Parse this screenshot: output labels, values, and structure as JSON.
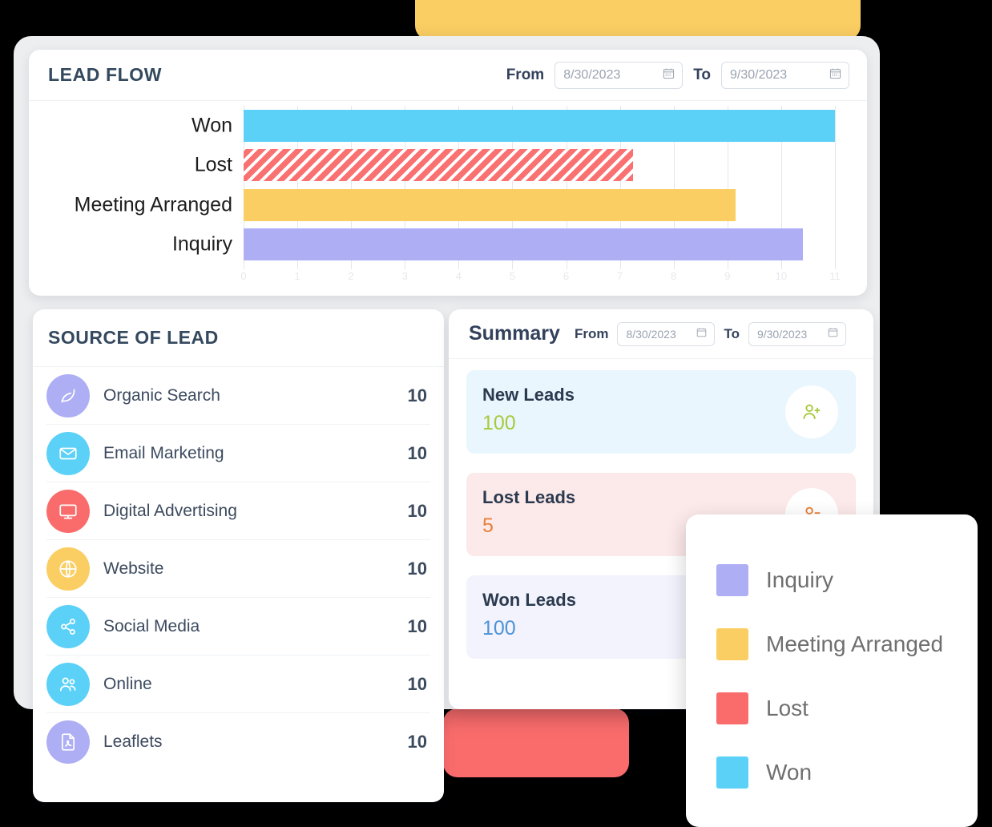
{
  "lead_flow": {
    "title": "LEAD FLOW",
    "from_label": "From",
    "to_label": "To",
    "from_value": "8/30/2023",
    "to_value": "9/30/2023",
    "calendar_icon": "calendar-icon"
  },
  "chart_data": {
    "type": "bar",
    "orientation": "horizontal",
    "title": "LEAD FLOW",
    "xlabel": "",
    "ylabel": "",
    "categories": [
      "Won",
      "Lost",
      "Meeting Arranged",
      "Inquiry"
    ],
    "values": [
      11,
      7.25,
      9.15,
      10.4
    ],
    "colors": [
      "#5BD1F7",
      "#FA7171",
      "#FBCE63",
      "#AEAEF5"
    ],
    "patterns": [
      "solid",
      "diagonal-stripes",
      "solid",
      "solid"
    ],
    "xlim": [
      0,
      11
    ],
    "xticks": [
      0,
      1,
      2,
      3,
      4,
      5,
      6,
      7,
      8,
      9,
      10,
      11
    ],
    "xticklabels": [
      "0",
      "1",
      "2",
      "3",
      "4",
      "5",
      "6",
      "7",
      "8",
      "9",
      "10",
      "11"
    ],
    "grid": true,
    "legend": {
      "position": "floating-bottom-right",
      "entries": [
        {
          "label": "Inquiry",
          "color": "#AEAEF5"
        },
        {
          "label": "Meeting Arranged",
          "color": "#FBCE63"
        },
        {
          "label": "Lost",
          "color": "#FA6C6C"
        },
        {
          "label": "Won",
          "color": "#5BD1F7"
        }
      ]
    }
  },
  "source_of_lead": {
    "title": "SOURCE OF LEAD",
    "rows": [
      {
        "name": "Organic Search",
        "value": "10",
        "icon": "leaf-icon",
        "color": "#AEAEF5"
      },
      {
        "name": "Email Marketing",
        "value": "10",
        "icon": "envelope-icon",
        "color": "#5BD1F7"
      },
      {
        "name": "Digital Advertising",
        "value": "10",
        "icon": "monitor-icon",
        "color": "#FA6C6C"
      },
      {
        "name": "Website",
        "value": "10",
        "icon": "globe-icon",
        "color": "#FBCE63"
      },
      {
        "name": "Social Media",
        "value": "10",
        "icon": "share-icon",
        "color": "#5BD1F7"
      },
      {
        "name": "Online",
        "value": "10",
        "icon": "users-icon",
        "color": "#5BD1F7"
      },
      {
        "name": "Leaflets",
        "value": "10",
        "icon": "pdf-file-icon",
        "color": "#AEAEF5"
      }
    ]
  },
  "summary": {
    "title": "Summary",
    "from_label": "From",
    "to_label": "To",
    "from_value": "8/30/2023",
    "to_value": "9/30/2023",
    "cards": [
      {
        "label": "New Leads",
        "value": "100",
        "icon": "user-plus-icon",
        "bg": "#E9F6FD",
        "value_color": "#A8C93D",
        "icon_color": "#A8C93D"
      },
      {
        "label": "Lost Leads",
        "value": "5",
        "icon": "user-minus-icon",
        "bg": "#FCE9E9",
        "value_color": "#E8803A",
        "icon_color": "#E8803A"
      },
      {
        "label": "Won Leads",
        "value": "100",
        "icon": "user-check-icon",
        "bg": "#F2F3FC",
        "value_color": "#4C92D8",
        "icon_color": "#4C92D8"
      }
    ]
  },
  "decor": {
    "yellow_color": "#FBCE63",
    "red_color": "#FA6C6C"
  }
}
